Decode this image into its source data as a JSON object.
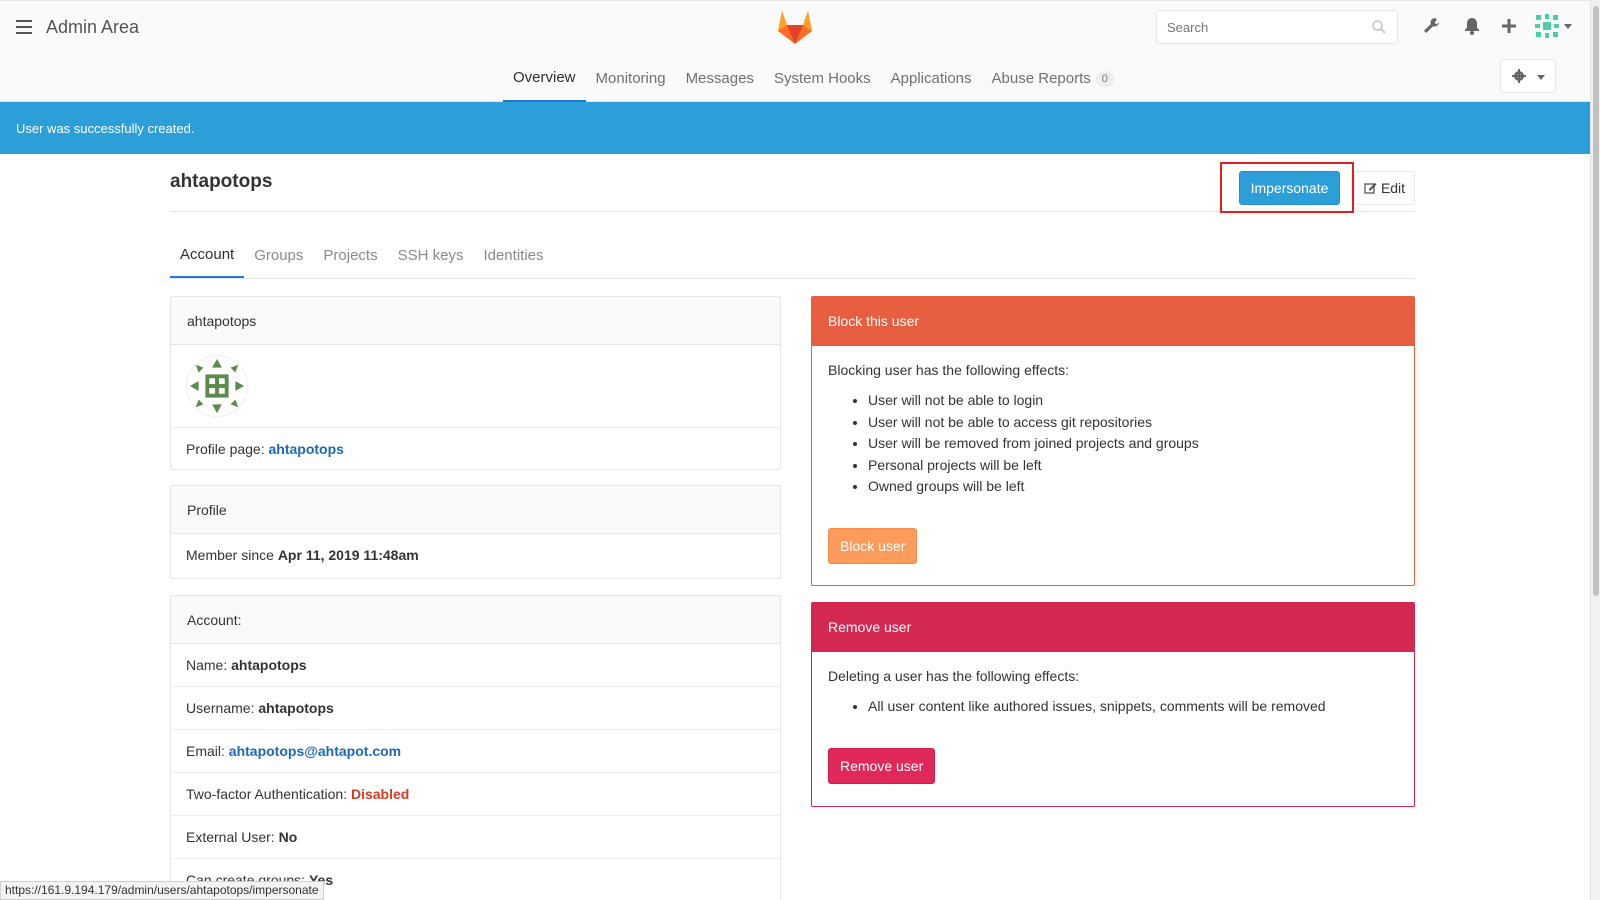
{
  "header": {
    "title": "Admin Area",
    "search_placeholder": "Search",
    "icons": [
      "hamburger-icon",
      "gitlab-logo",
      "search-icon",
      "wrench-icon",
      "bell-icon",
      "plus-icon",
      "user-avatar",
      "gear-icon"
    ]
  },
  "nav": {
    "items": [
      {
        "label": "Overview",
        "active": true
      },
      {
        "label": "Monitoring"
      },
      {
        "label": "Messages"
      },
      {
        "label": "System Hooks"
      },
      {
        "label": "Applications"
      },
      {
        "label": "Abuse Reports",
        "badge": "0"
      }
    ]
  },
  "flash": {
    "message": "User was successfully created."
  },
  "user": {
    "title": "ahtapotops",
    "impersonate_label": "Impersonate",
    "edit_label": "Edit"
  },
  "tabs": [
    "Account",
    "Groups",
    "Projects",
    "SSH keys",
    "Identities"
  ],
  "card_user": {
    "header": "ahtapotops",
    "profile_label": "Profile page: ",
    "profile_link": "ahtapotops"
  },
  "card_profile": {
    "header": "Profile",
    "member_since_label": "Member since ",
    "member_since_value": "Apr 11, 2019 11:48am"
  },
  "card_account": {
    "header": "Account:",
    "name_label": "Name: ",
    "name_value": "ahtapotops",
    "username_label": "Username: ",
    "username_value": "ahtapotops",
    "email_label": "Email: ",
    "email_value": "ahtapotops@ahtapot.com",
    "twofa_label": "Two-factor Authentication: ",
    "twofa_value": "Disabled",
    "external_label": "External User: ",
    "external_value": "No",
    "create_groups_label": "Can create groups: ",
    "create_groups_value": "Yes"
  },
  "block_panel": {
    "header": "Block this user",
    "intro": "Blocking user has the following effects:",
    "effects": [
      "User will not be able to login",
      "User will not be able to access git repositories",
      "User will be removed from joined projects and groups",
      "Personal projects will be left",
      "Owned groups will be left"
    ],
    "button": "Block user",
    "color": "#e75e40"
  },
  "remove_panel": {
    "header": "Remove user",
    "intro": "Deleting a user has the following effects:",
    "effects": [
      "All user content like authored issues, snippets, comments will be removed"
    ],
    "button": "Remove user",
    "color": "#d22852"
  },
  "status_bar": {
    "url": "https://161.9.194.179/admin/users/ahtapotops/impersonate"
  }
}
